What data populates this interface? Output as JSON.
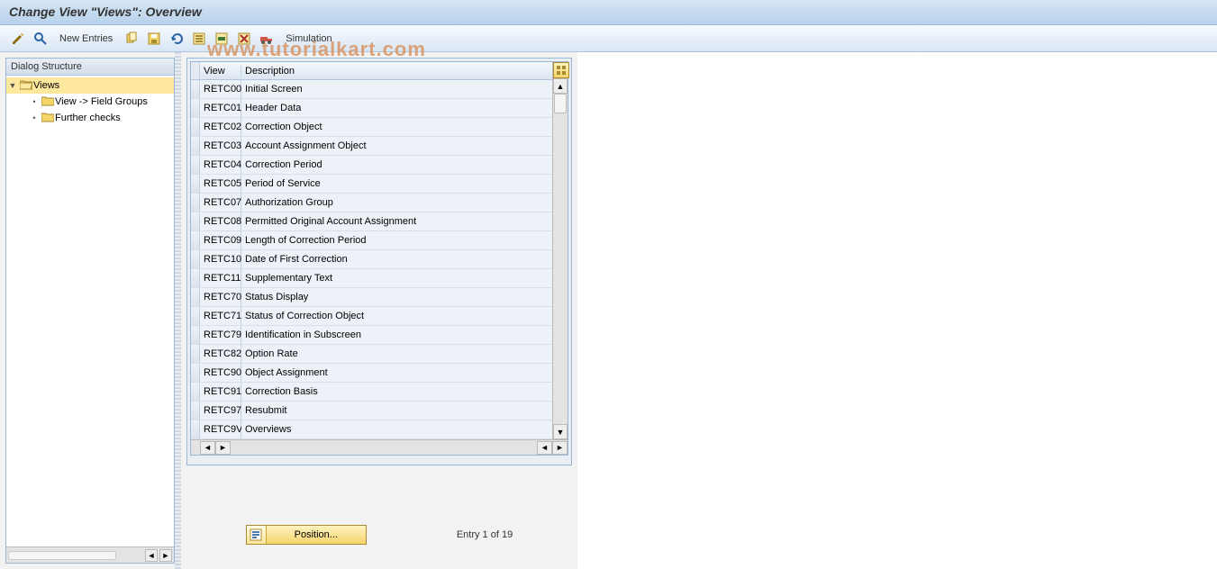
{
  "title": "Change View \"Views\": Overview",
  "toolbar": {
    "new_entries": "New Entries",
    "simulation": "Simulation"
  },
  "watermark": "www.tutorialkart.com",
  "dialog_structure": {
    "header": "Dialog Structure",
    "items": [
      {
        "label": "Views",
        "level": 0,
        "selected": true,
        "open_folder": true,
        "expanded": true
      },
      {
        "label": "View -> Field Groups",
        "level": 1,
        "selected": false,
        "open_folder": false
      },
      {
        "label": "Further checks",
        "level": 1,
        "selected": false,
        "open_folder": false
      }
    ]
  },
  "table": {
    "headers": {
      "view": "View",
      "description": "Description"
    },
    "rows": [
      {
        "view": "RETC00",
        "desc": "Initial Screen"
      },
      {
        "view": "RETC01",
        "desc": "Header Data"
      },
      {
        "view": "RETC02",
        "desc": "Correction Object"
      },
      {
        "view": "RETC03",
        "desc": "Account Assignment Object"
      },
      {
        "view": "RETC04",
        "desc": "Correction Period"
      },
      {
        "view": "RETC05",
        "desc": "Period of Service"
      },
      {
        "view": "RETC07",
        "desc": "Authorization Group"
      },
      {
        "view": "RETC08",
        "desc": "Permitted Original Account Assignment"
      },
      {
        "view": "RETC09",
        "desc": "Length of Correction Period"
      },
      {
        "view": "RETC10",
        "desc": "Date of First Correction"
      },
      {
        "view": "RETC11",
        "desc": "Supplementary Text"
      },
      {
        "view": "RETC70",
        "desc": "Status Display"
      },
      {
        "view": "RETC71",
        "desc": "Status of Correction Object"
      },
      {
        "view": "RETC79",
        "desc": "Identification in Subscreen"
      },
      {
        "view": "RETC82",
        "desc": "Option Rate"
      },
      {
        "view": "RETC90",
        "desc": "Object Assignment"
      },
      {
        "view": "RETC91",
        "desc": "Correction Basis"
      },
      {
        "view": "RETC97",
        "desc": "Resubmit"
      },
      {
        "view": "RETC9V",
        "desc": "Overviews"
      }
    ]
  },
  "position_button": "Position...",
  "entry_status": "Entry 1 of 19"
}
